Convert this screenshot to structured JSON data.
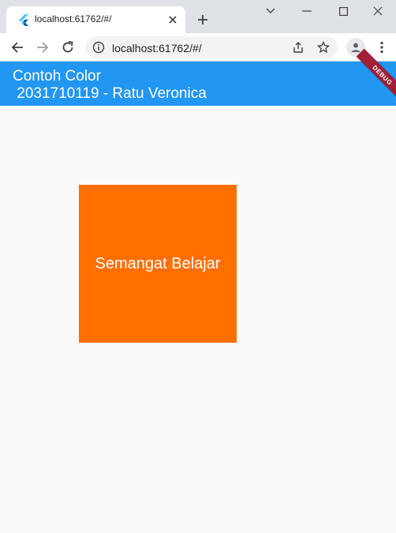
{
  "browser": {
    "tab": {
      "title": "localhost:61762/#/"
    },
    "address_bar": {
      "url": "localhost:61762/#/"
    },
    "icons": {
      "favicon": "flutter-icon",
      "tab_close": "close-icon",
      "new_tab": "plus-icon",
      "minimize": "minimize-icon",
      "maximize": "maximize-icon",
      "close_window": "close-icon",
      "tab_search": "chevron-down-icon",
      "back": "arrow-left-icon",
      "forward": "arrow-right-icon",
      "reload": "reload-icon",
      "site_info": "info-icon",
      "share": "share-icon",
      "bookmark": "star-icon",
      "profile": "person-icon",
      "menu": "kebab-icon"
    }
  },
  "app": {
    "appbar": {
      "title": "Contoh Color\n 2031710119 - Ratu Veronica",
      "color": "#2196f3"
    },
    "debug_banner": {
      "label": "DEBUG"
    },
    "box": {
      "text": "Semangat Belajar",
      "color": "#ff6f00"
    }
  }
}
